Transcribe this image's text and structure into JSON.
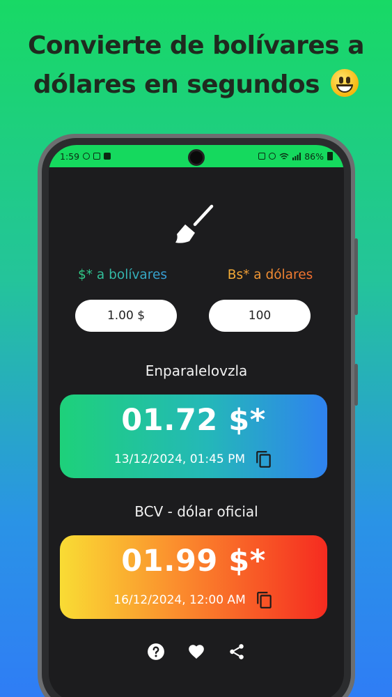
{
  "headline": {
    "line1": "Convierte de bolívares a",
    "line2": "dólares en segundos"
  },
  "statusbar": {
    "time": "1:59",
    "battery": "86%"
  },
  "converter": {
    "usd_label": "$* a bolívares",
    "bs_label": "Bs* a dólares",
    "usd_value": "1.00 $",
    "bs_value": "100"
  },
  "rates": [
    {
      "source": "Enparalelovzla",
      "value": "01.72 $*",
      "date": "13/12/2024, 01:45 PM"
    },
    {
      "source": "BCV - dólar oficial",
      "value": "01.99 $*",
      "date": "16/12/2024, 12:00 AM"
    }
  ],
  "icons": {
    "clear": "broom-icon",
    "copy": "copy-icon",
    "help": "help-icon",
    "favorite": "heart-icon",
    "share": "share-icon"
  },
  "colors": {
    "statusbar": "#15d95e",
    "screen_bg": "#1c1c1e",
    "green_card_start": "#1ed17a",
    "green_card_end": "#2f82ef",
    "red_card_start": "#f9dc34",
    "red_card_end": "#f52b20"
  }
}
